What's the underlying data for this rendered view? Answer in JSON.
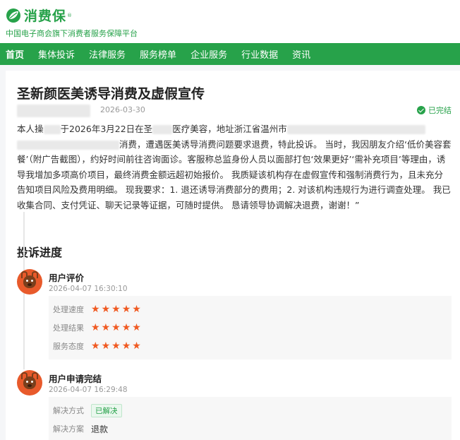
{
  "brand": {
    "name": "消费保",
    "reg_mark": "®",
    "tagline": "中国电子商会旗下消费者服务保障平台",
    "color": "#27a24a"
  },
  "nav": {
    "items": [
      {
        "label": "首页",
        "active": true
      },
      {
        "label": "集体投诉"
      },
      {
        "label": "法律服务"
      },
      {
        "label": "服务榜单"
      },
      {
        "label": "企业服务"
      },
      {
        "label": "行业数据"
      },
      {
        "label": "资讯"
      }
    ]
  },
  "complaint": {
    "title": "圣新颜医美诱导消费及虚假宣传",
    "date": "2026-03-30",
    "status": "已完结",
    "body": {
      "p1": "本人操",
      "p2": "于2026年3月22日在圣",
      "p3": "医疗美容，地址浙江省温州市",
      "p4": "消费，遭遇医美诱导消费问题要求退费，特此投诉。 当时，我因朋友介绍‘低价美容套餐’（附广告截图），约好时间前往咨询面诊。客服称总监身份人员以面部打包‘效果更好’‘需补充项目’等理由，诱导我增加多项高价项目，最终消费金额远超初始报价。 我质疑该机构存在虚假宣传和强制消费行为，且未充分告知项目风险及费用明细。 现我要求：1. 退还诱导消费部分的费用；2. 对该机构违规行为进行调查处理。 我已收集合同、支付凭证、聊天记录等证据，可随时提供。 恳请领导协调解决退费，谢谢！”"
    }
  },
  "progress": {
    "title": "投诉进度",
    "events": [
      {
        "heading": "用户评价",
        "time": "2026-04-07 16:30:10",
        "ratings": [
          {
            "label": "处理速度",
            "stars": 5
          },
          {
            "label": "处理结果",
            "stars": 5
          },
          {
            "label": "服务态度",
            "stars": 5
          }
        ]
      },
      {
        "heading": "用户申请完结",
        "time": "2026-04-07 16:29:48",
        "method_label": "解决方式",
        "method_value": "已解决",
        "plan_label": "解决方案",
        "plan_value": "退款"
      }
    ]
  },
  "icons": {
    "logo": "leaf-logo-icon",
    "status": "check-circle-icon",
    "avatar": "deer-avatar-icon",
    "star": "star-icon"
  }
}
